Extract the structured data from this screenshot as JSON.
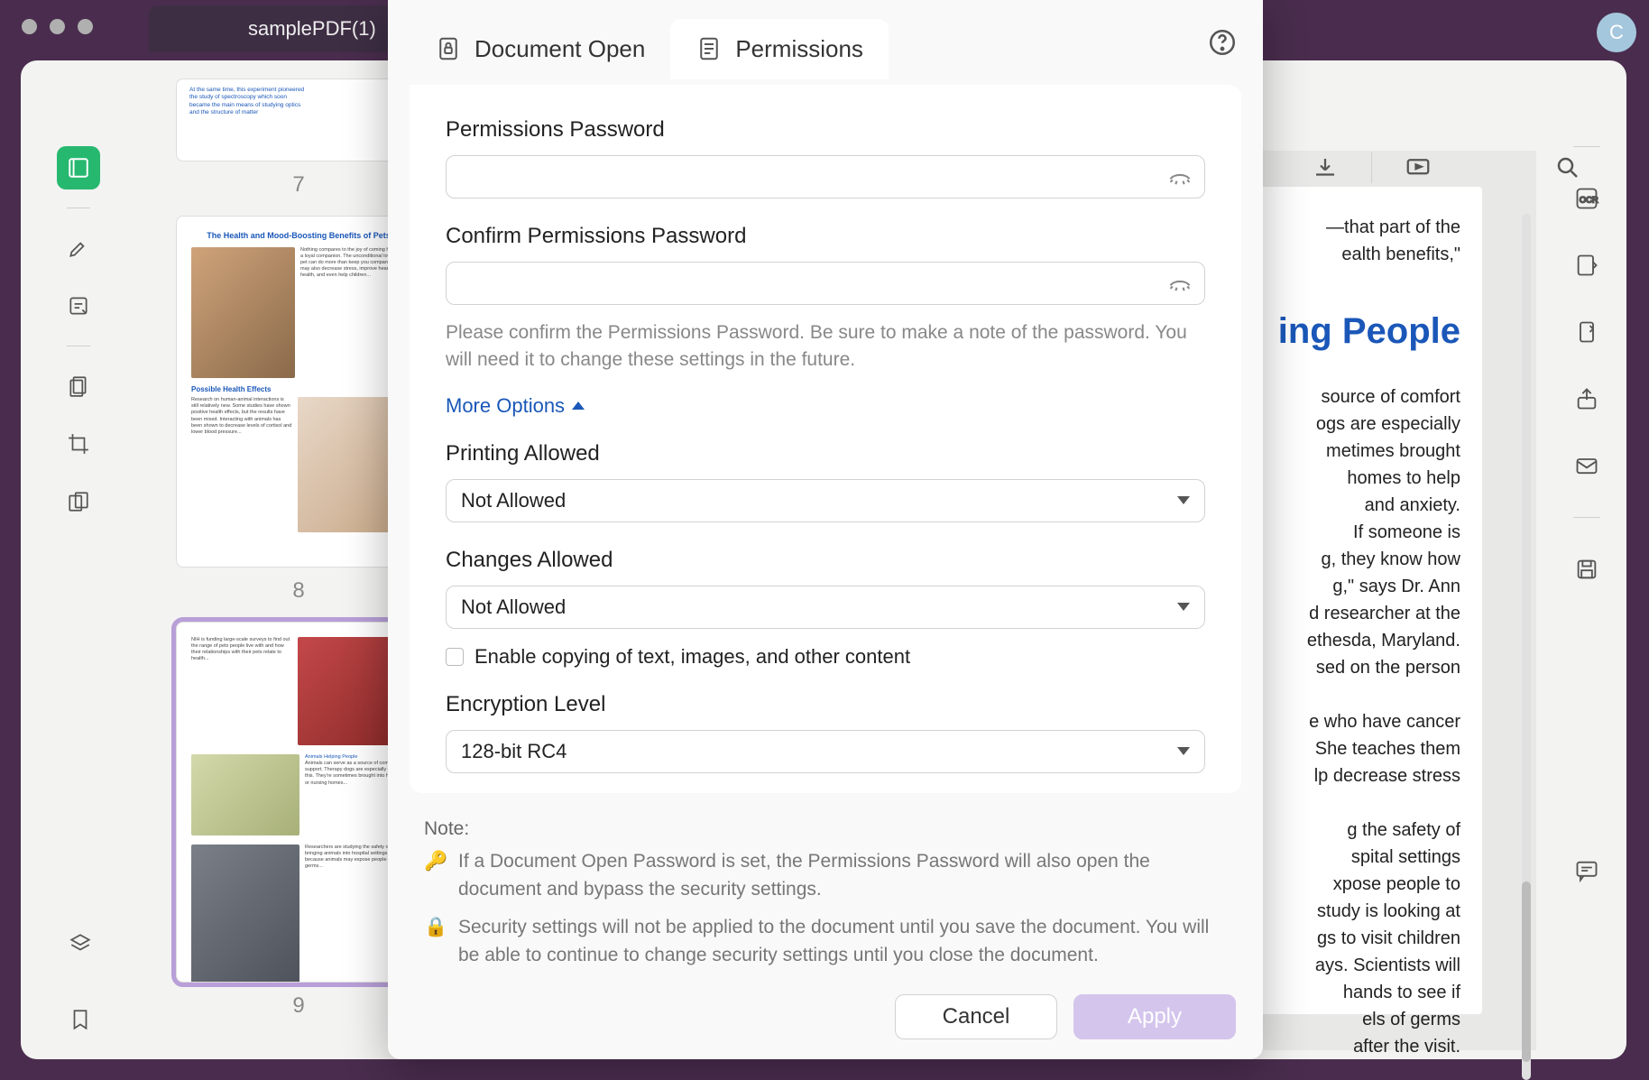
{
  "window": {
    "tab_title": "samplePDF(1)",
    "avatar_letter": "C"
  },
  "thumbnails": {
    "p7": {
      "num": "7"
    },
    "p8": {
      "num": "8",
      "title": "The Health and Mood-Boosting Benefits of Pets",
      "sub": "Possible Health Effects"
    },
    "p9": {
      "num": "9",
      "sub": "Animals Helping People"
    }
  },
  "doc_preview": {
    "frag1a": "—that part of the",
    "frag1b": "ealth benefits,\"",
    "heading": "ing People",
    "body": " source of comfort\nogs are especially\nmetimes brought\n homes to help\nand anxiety.\nIf someone is\ng, they know how\ng,\"  says  Dr.  Ann\nd researcher at the\nethesda, Maryland.\nsed  on  the  person\n\ne who have cancer\nShe  teaches  them\nlp decrease stress\n\ng the safety of\nspital settings\nxpose people to\nstudy is looking at\ngs to visit children\nays. Scientists will\nhands to see if\nels of  germs\n after the visit."
  },
  "dialog": {
    "tab_doc_open": "Document Open",
    "tab_permissions": "Permissions",
    "perm_pw_label": "Permissions Password",
    "confirm_pw_label": "Confirm Permissions Password",
    "confirm_hint": "Please confirm the Permissions Password. Be sure to make a note of the password. You will need it to change these settings in the future.",
    "more_options": "More Options",
    "printing_label": "Printing Allowed",
    "printing_value": "Not Allowed",
    "changes_label": "Changes Allowed",
    "changes_value": "Not Allowed",
    "copy_checkbox": "Enable copying of text, images, and other content",
    "encryption_label": "Encryption Level",
    "encryption_value": "128-bit RC4",
    "note_label": "Note:",
    "note1": "If a Document Open Password is set, the Permissions Password will also open the document and bypass the security settings.",
    "note2": "Security settings will not be applied to the document until you save the document. You will be able to continue to change security settings until you close the document.",
    "cancel": "Cancel",
    "apply": "Apply"
  }
}
